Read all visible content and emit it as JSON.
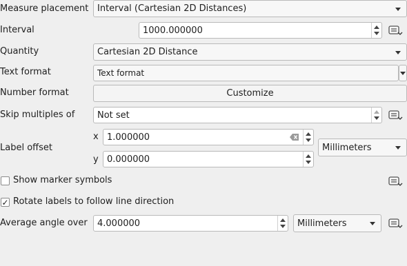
{
  "measure_placement": {
    "label": "Measure placement",
    "value": "Interval (Cartesian 2D Distances)"
  },
  "interval": {
    "label": "Interval",
    "value": "1000.000000"
  },
  "quantity": {
    "label": "Quantity",
    "value": "Cartesian 2D Distance"
  },
  "text_format": {
    "label": "Text format",
    "value": "Text format"
  },
  "number_format": {
    "label": "Number format",
    "button": "Customize"
  },
  "skip_multiples": {
    "label": "Skip multiples of",
    "value": "Not set"
  },
  "label_offset": {
    "label": "Label offset",
    "x_label": "x",
    "x_value": "1.000000",
    "y_label": "y",
    "y_value": "0.000000",
    "unit": "Millimeters"
  },
  "show_marker_symbols": {
    "label": "Show marker symbols",
    "checked": false
  },
  "rotate_labels": {
    "label": "Rotate labels to follow line direction",
    "checked": true,
    "check_mark": "✓"
  },
  "average_angle": {
    "label": "Average angle over",
    "value": "4.000000",
    "unit": "Millimeters"
  },
  "icons": [
    "data-defined-override-icon",
    "clear-icon",
    "chevron-down-icon",
    "spin-up-icon",
    "spin-down-icon"
  ]
}
